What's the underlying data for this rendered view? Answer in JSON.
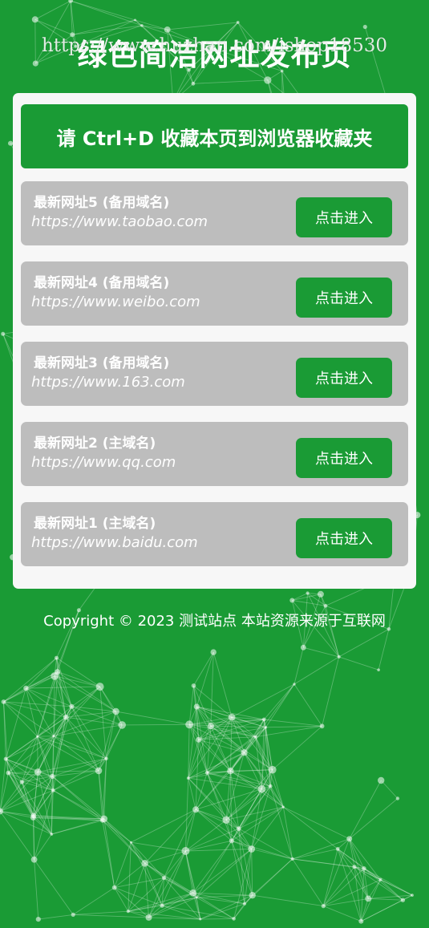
{
  "header": {
    "title": "绿色简洁网址发布页",
    "watermark": "https://www.huzhan.com/ishop18530"
  },
  "notice": {
    "text": "请 Ctrl+D 收藏本页到浏览器收藏夹"
  },
  "links": [
    {
      "title": "最新网址5 (备用域名)",
      "url": "https://www.taobao.com",
      "button": "点击进入"
    },
    {
      "title": "最新网址4 (备用域名)",
      "url": "https://www.weibo.com",
      "button": "点击进入"
    },
    {
      "title": "最新网址3 (备用域名)",
      "url": "https://www.163.com",
      "button": "点击进入"
    },
    {
      "title": "最新网址2 (主域名)",
      "url": "https://www.qq.com",
      "button": "点击进入"
    },
    {
      "title": "最新网址1 (主域名)",
      "url": "https://www.baidu.com",
      "button": "点击进入"
    }
  ],
  "footer": {
    "text": "Copyright © 2023 测试站点 本站资源来源于互联网"
  },
  "colors": {
    "brand_green": "#1a9b35",
    "card_gray": "#bdbdbd",
    "panel_bg": "#f7f7f7"
  }
}
